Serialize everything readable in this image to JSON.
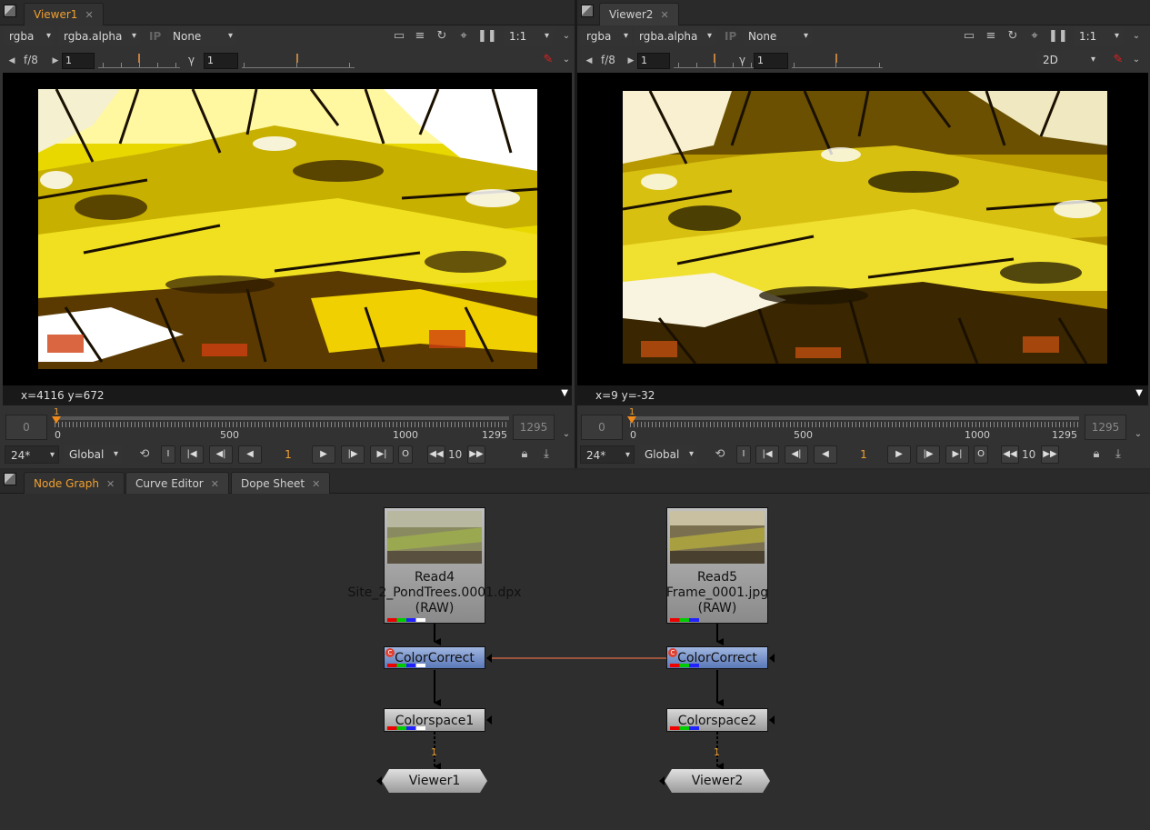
{
  "viewer1": {
    "tab": "Viewer1",
    "close": "✕",
    "channels": "rgba",
    "alpha": "rgba.alpha",
    "ip": "IP",
    "lut_none": "None",
    "zoom": "1:1",
    "fstop": "f/8",
    "gain_value": "1",
    "gamma_label": "γ",
    "gamma_value": "1",
    "coords": "x=4116 y=672",
    "tl_start": "0",
    "tl_end": "1295",
    "ruler": [
      "0",
      "500",
      "1000",
      "1295"
    ],
    "playhead": "1",
    "fps": "24*",
    "scope": "Global",
    "frame": "1",
    "step": "10",
    "in_label": "I",
    "out_label": "O",
    "playhead_fraction": 0.0
  },
  "viewer2": {
    "tab": "Viewer2",
    "close": "✕",
    "channels": "rgba",
    "alpha": "rgba.alpha",
    "ip": "IP",
    "lut_none": "None",
    "zoom": "1:1",
    "fstop": "f/8",
    "gain_value": "1",
    "gamma_label": "γ",
    "gamma_value": "1",
    "view_mode": "2D",
    "coords": "x=9 y=-32",
    "tl_start": "0",
    "tl_end": "1295",
    "ruler": [
      "0",
      "500",
      "1000",
      "1295"
    ],
    "playhead": "1",
    "fps": "24*",
    "scope": "Global",
    "frame": "1",
    "step": "10",
    "in_label": "I",
    "out_label": "O",
    "playhead_fraction": 0.0
  },
  "bottom_tabs": [
    {
      "label": "Node Graph"
    },
    {
      "label": "Curve Editor"
    },
    {
      "label": "Dope Sheet"
    }
  ],
  "nodes": {
    "read4": {
      "name": "Read4",
      "file": "Site_2_PondTrees.0001.dpx",
      "mode": "(RAW)"
    },
    "read5": {
      "name": "Read5",
      "file": "Frame_0001.jpg",
      "mode": "(RAW)"
    },
    "cc1": {
      "name": "ColorCorrect"
    },
    "cc2": {
      "name": "ColorCorrect"
    },
    "cs1": {
      "name": "Colorspace1"
    },
    "cs2": {
      "name": "Colorspace2"
    },
    "v1": {
      "name": "Viewer1",
      "pipe": "1"
    },
    "v2": {
      "name": "Viewer2",
      "pipe": "1"
    }
  },
  "colors": {
    "accent": "#f0a030",
    "node_cc": "#7a96cc",
    "link": "#c06040"
  }
}
